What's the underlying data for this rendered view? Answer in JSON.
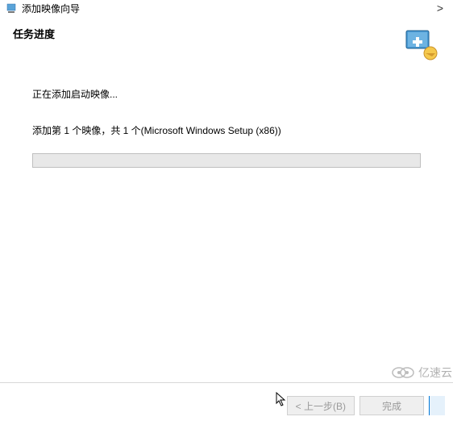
{
  "window": {
    "title": "添加映像向导"
  },
  "header": {
    "title": "任务进度"
  },
  "content": {
    "status_text": "正在添加启动映像...",
    "detail_text": "添加第 1 个映像，共 1 个(Microsoft Windows Setup (x86))"
  },
  "buttons": {
    "back_label": "< 上一步(B)",
    "finish_label": "完成"
  },
  "watermark": {
    "text": "亿速云"
  }
}
